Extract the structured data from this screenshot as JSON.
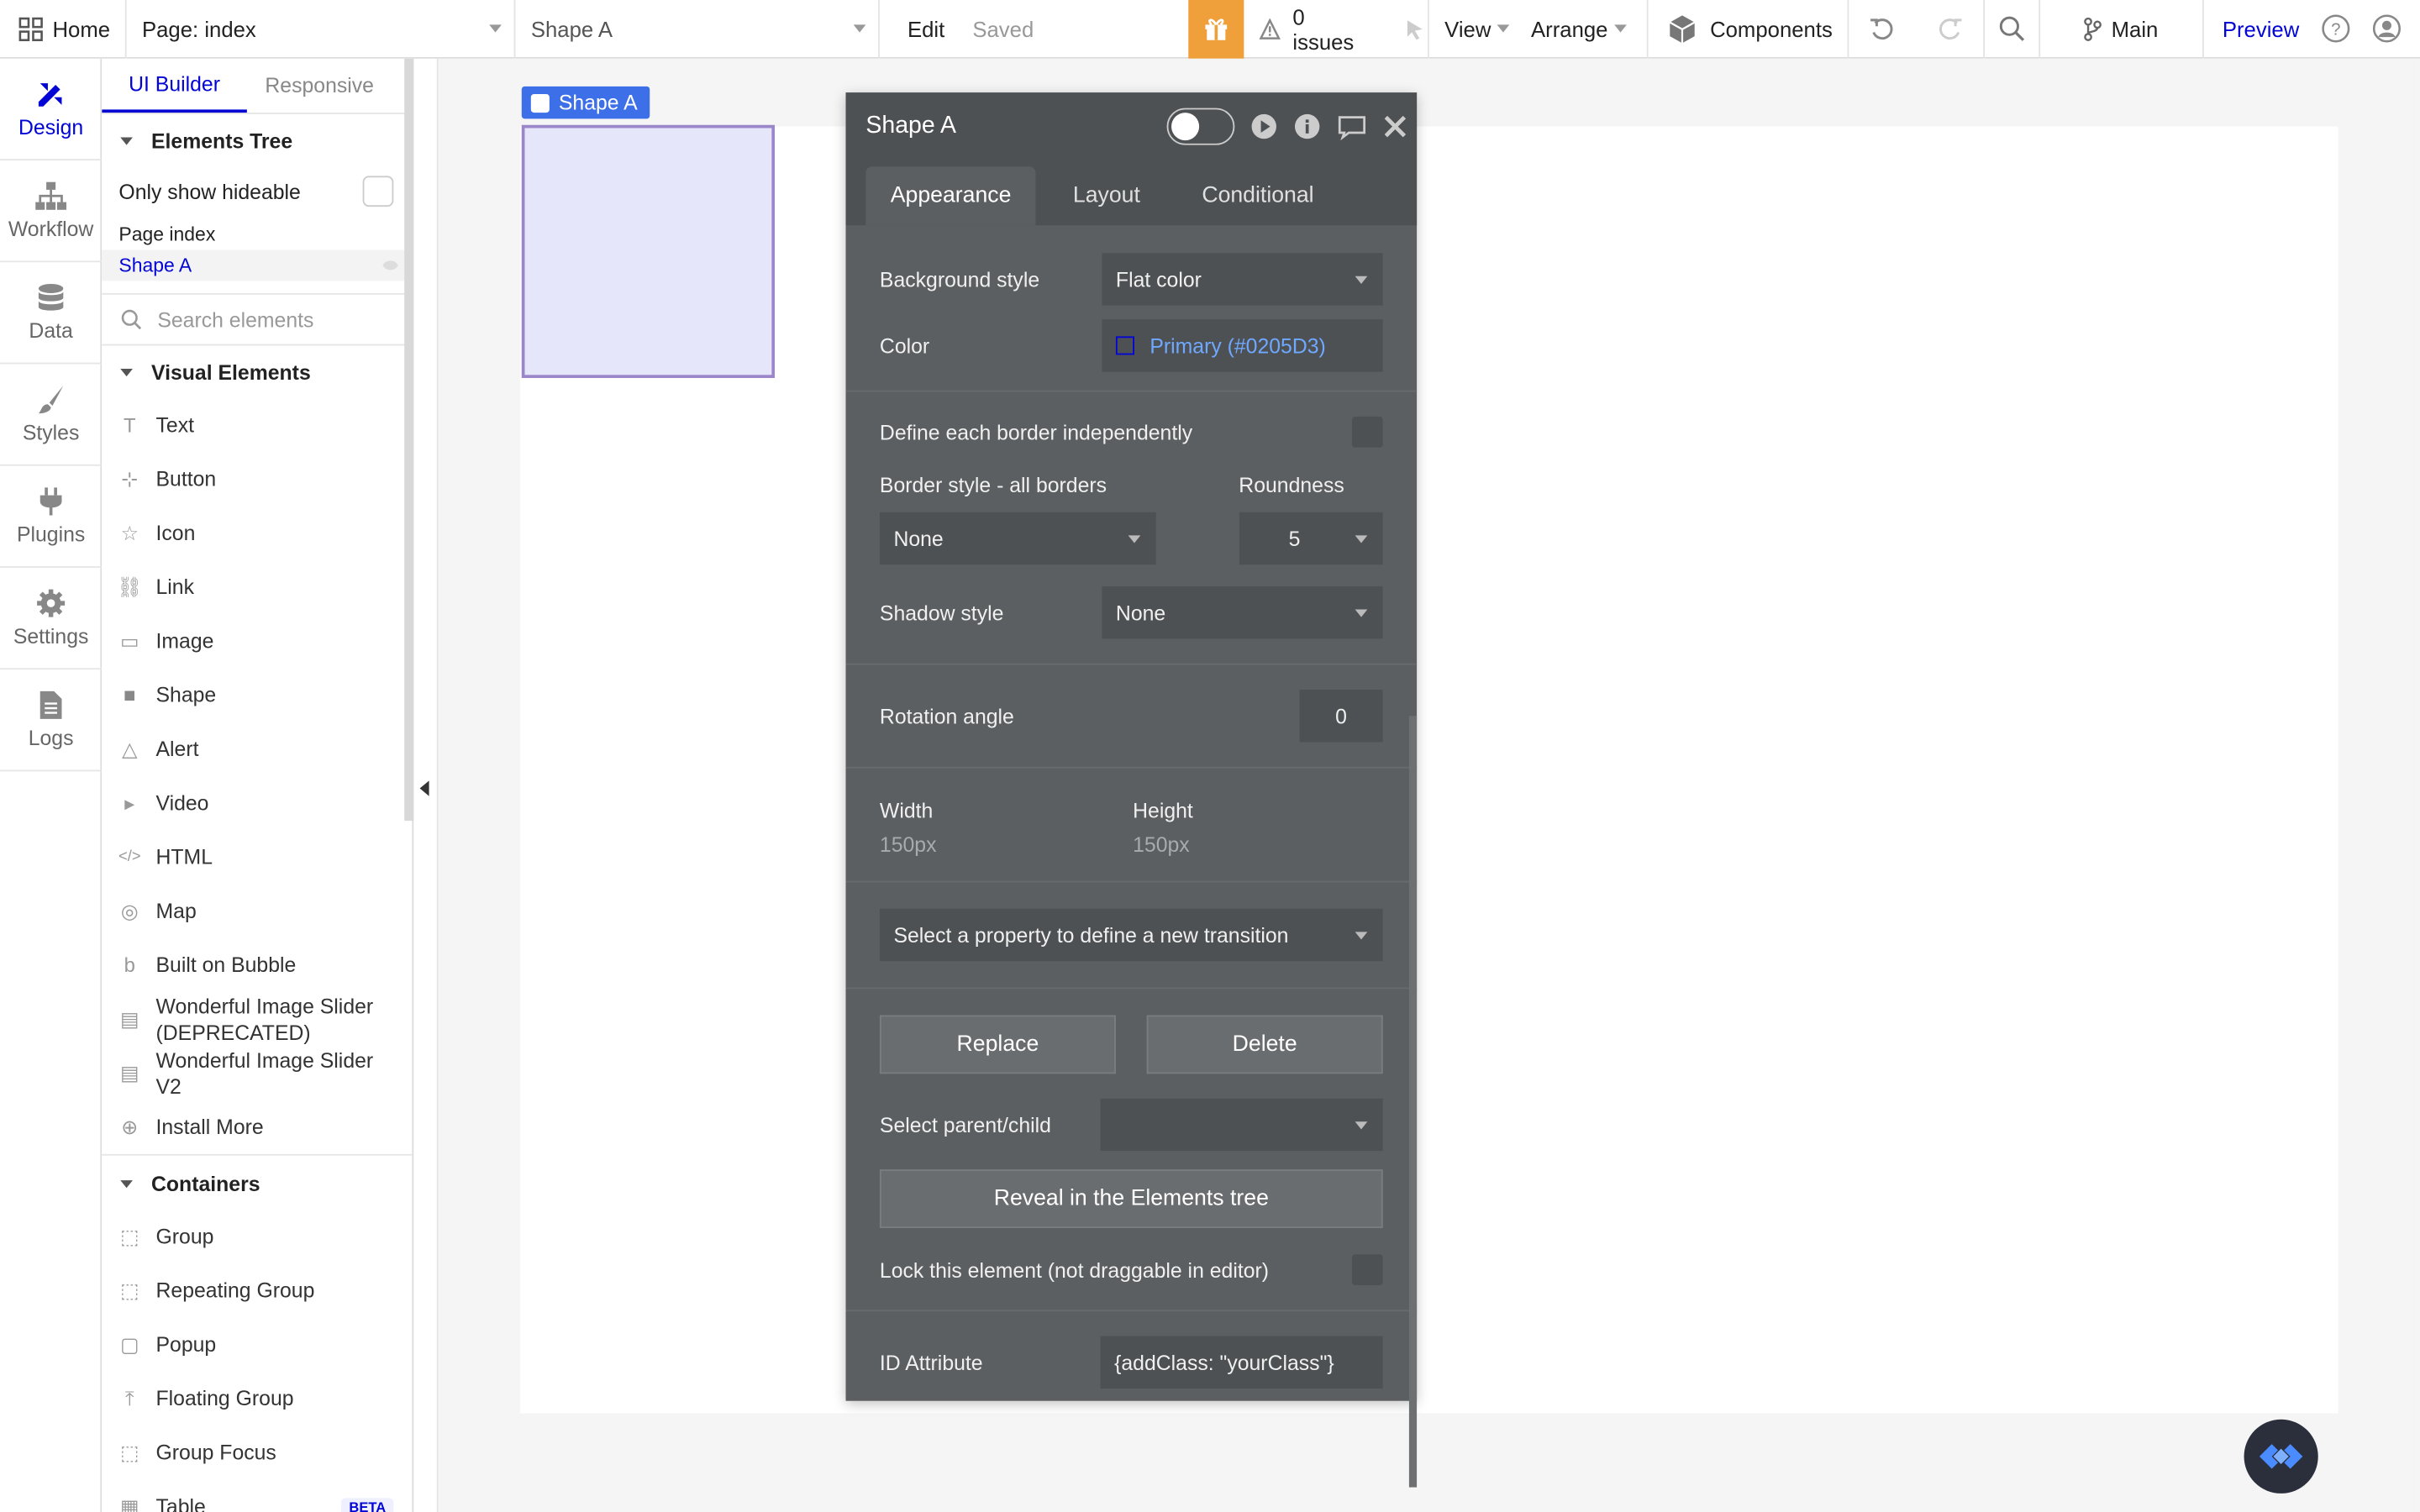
{
  "topbar": {
    "home_label": "Home",
    "page_label": "Page: index",
    "element_label": "Shape A",
    "edit_label": "Edit",
    "saved_label": "Saved",
    "issues_label": "0 issues",
    "view_label": "View",
    "arrange_label": "Arrange",
    "components_label": "Components",
    "branch_label": "Main",
    "preview_label": "Preview"
  },
  "rail": {
    "items": [
      {
        "label": "Design",
        "icon": "design-icon"
      },
      {
        "label": "Workflow",
        "icon": "workflow-icon"
      },
      {
        "label": "Data",
        "icon": "data-icon"
      },
      {
        "label": "Styles",
        "icon": "styles-icon"
      },
      {
        "label": "Plugins",
        "icon": "plugins-icon"
      },
      {
        "label": "Settings",
        "icon": "settings-icon"
      },
      {
        "label": "Logs",
        "icon": "logs-icon"
      }
    ]
  },
  "panel": {
    "tabs": [
      "UI Builder",
      "Responsive"
    ],
    "elements_tree_title": "Elements Tree",
    "only_show_hideable": "Only show hideable",
    "tree": [
      "Page index",
      "Shape A"
    ],
    "search_placeholder": "Search elements",
    "visual_title": "Visual Elements",
    "visual": [
      {
        "label": "Text",
        "icon": "T"
      },
      {
        "label": "Button",
        "icon": "⊹"
      },
      {
        "label": "Icon",
        "icon": "☆"
      },
      {
        "label": "Link",
        "icon": "⛓"
      },
      {
        "label": "Image",
        "icon": "▭"
      },
      {
        "label": "Shape",
        "icon": "■"
      },
      {
        "label": "Alert",
        "icon": "△"
      },
      {
        "label": "Video",
        "icon": "▸"
      },
      {
        "label": "HTML",
        "icon": "</>"
      },
      {
        "label": "Map",
        "icon": "◎"
      },
      {
        "label": "Built on Bubble",
        "icon": "b"
      },
      {
        "label": "Wonderful Image Slider (DEPRECATED)",
        "icon": "▤"
      },
      {
        "label": "Wonderful Image Slider V2",
        "icon": "▤"
      },
      {
        "label": "Install More",
        "icon": "⊕"
      }
    ],
    "containers_title": "Containers",
    "containers": [
      {
        "label": "Group",
        "icon": "⬚"
      },
      {
        "label": "Repeating Group",
        "icon": "⬚"
      },
      {
        "label": "Popup",
        "icon": "▢"
      },
      {
        "label": "Floating Group",
        "icon": "⤒"
      },
      {
        "label": "Group Focus",
        "icon": "⬚"
      },
      {
        "label": "Table",
        "icon": "▦",
        "badge": "BETA"
      }
    ]
  },
  "canvas": {
    "shape_label": "Shape A",
    "shape_fill": "#E6E6FA",
    "shape_border": "#9B86C9"
  },
  "editor": {
    "title": "Shape A",
    "tabs": [
      "Appearance",
      "Layout",
      "Conditional"
    ],
    "background_style_label": "Background style",
    "background_style_value": "Flat color",
    "color_label": "Color",
    "color_value": "Primary (#0205D3)",
    "border_independent_label": "Define each border independently",
    "border_style_label": "Border style - all borders",
    "roundness_label": "Roundness",
    "border_style_value": "None",
    "roundness_value": "5",
    "shadow_label": "Shadow style",
    "shadow_value": "None",
    "rotation_label": "Rotation angle",
    "rotation_value": "0",
    "width_label": "Width",
    "width_value": "150px",
    "height_label": "Height",
    "height_value": "150px",
    "transition_placeholder": "Select a property to define a new transition",
    "replace_label": "Replace",
    "delete_label": "Delete",
    "parent_child_label": "Select parent/child",
    "reveal_label": "Reveal in the Elements tree",
    "lock_label": "Lock this element (not draggable in editor)",
    "id_label": "ID Attribute",
    "id_value": "{addClass: \"yourClass\"}"
  },
  "colors": {
    "accent": "#0205D3",
    "gift": "#F0A03A",
    "editor_bg": "#5C5F61"
  }
}
